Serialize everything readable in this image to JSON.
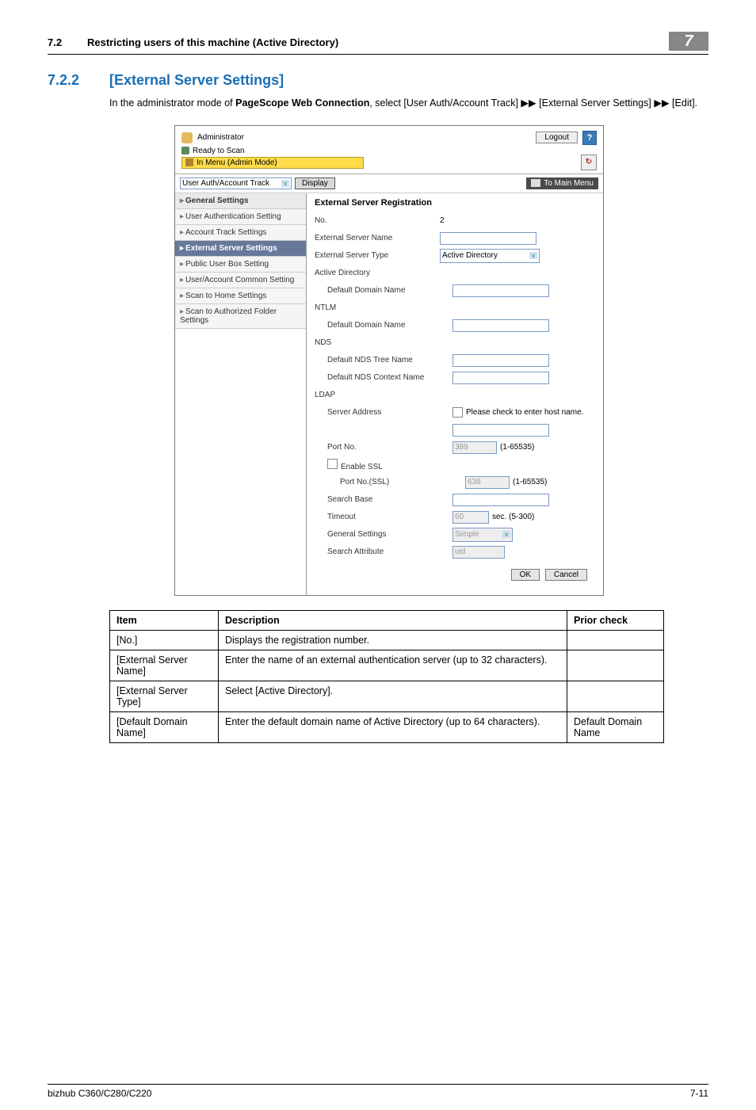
{
  "header": {
    "section": "7.2",
    "title": "Restricting users of this machine (Active Directory)",
    "chapter": "7"
  },
  "heading": {
    "num": "7.2.2",
    "title": "[External Server Settings]"
  },
  "intro": {
    "prefix": "In the administrator mode of ",
    "bold": "PageScope Web Connection",
    "mid": ", select [User Auth/Account Track] ",
    "arrow1": "▶▶",
    "seg2": " [External Server Settings] ",
    "arrow2": "▶▶",
    "seg3": " [Edit]."
  },
  "shot": {
    "admin": "Administrator",
    "logout": "Logout",
    "help": "?",
    "ready": "Ready to Scan",
    "mode": "In Menu (Admin Mode)",
    "dd": "User Auth/Account Track",
    "display": "Display",
    "tomain": "To Main Menu",
    "side": {
      "i0": "General Settings",
      "i1": "User Authentication Setting",
      "i2": "Account Track Settings",
      "i3": "External Server Settings",
      "i4": "Public User Box Setting",
      "i5": "User/Account Common Setting",
      "i6": "Scan to Home Settings",
      "i7": "Scan to Authorized Folder Settings"
    },
    "main": {
      "title": "External Server Registration",
      "no_label": "No.",
      "no_val": "2",
      "name_label": "External Server Name",
      "type_label": "External Server Type",
      "type_val": "Active Directory",
      "ad_head": "Active Directory",
      "ad_domain": "Default Domain Name",
      "ntlm_head": "NTLM",
      "ntlm_domain": "Default Domain Name",
      "nds_head": "NDS",
      "nds_tree": "Default NDS Tree Name",
      "nds_ctx": "Default NDS Context Name",
      "ldap_head": "LDAP",
      "server_addr": "Server Address",
      "host_check": "Please check to enter host name.",
      "port_label": "Port No.",
      "port_val": "389",
      "port_range": "(1-65535)",
      "ssl_label": "Enable SSL",
      "sslport_label": "Port No.(SSL)",
      "sslport_val": "636",
      "search_base": "Search Base",
      "timeout_label": "Timeout",
      "timeout_val": "60",
      "timeout_unit": "sec. (5-300)",
      "gen_label": "General Settings",
      "gen_val": "Simple",
      "attr_label": "Search Attribute",
      "attr_val": "uid",
      "ok": "OK",
      "cancel": "Cancel"
    }
  },
  "table": {
    "h1": "Item",
    "h2": "Description",
    "h3": "Prior check",
    "rows": [
      {
        "item": "[No.]",
        "desc": "Displays the registration number.",
        "prior": ""
      },
      {
        "item": "[External Server Name]",
        "desc": "Enter the name of an external authentication server (up to 32 characters).",
        "prior": ""
      },
      {
        "item": "[External Server Type]",
        "desc": "Select [Active Directory].",
        "prior": ""
      },
      {
        "item": "[Default Domain Name]",
        "desc": "Enter the default domain name of Active Directory (up to 64 characters).",
        "prior": "Default Domain Name"
      }
    ]
  },
  "footer": {
    "left": "bizhub C360/C280/C220",
    "right": "7-11"
  }
}
